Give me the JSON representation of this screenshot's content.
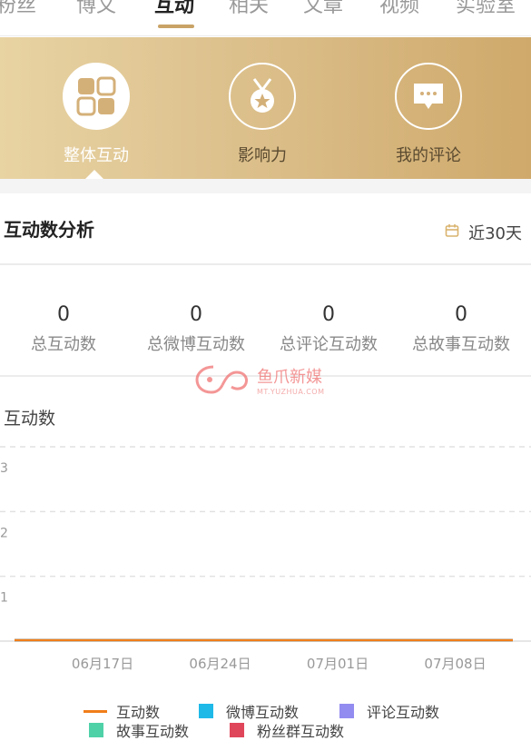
{
  "top_tabs": [
    {
      "label": "粉丝"
    },
    {
      "label": "博文"
    },
    {
      "label": "互动"
    },
    {
      "label": "相关"
    },
    {
      "label": "文章"
    },
    {
      "label": "视频"
    },
    {
      "label": "实验室"
    }
  ],
  "active_tab": "互动",
  "features": [
    {
      "label": "整体互动",
      "icon": "interaction-swap-icon"
    },
    {
      "label": "影响力",
      "icon": "medal-icon"
    },
    {
      "label": "我的评论",
      "icon": "comment-icon"
    }
  ],
  "section": {
    "title": "互动数分析",
    "date_range": "近30天",
    "calendar_icon": "calendar-icon"
  },
  "stats": [
    {
      "value": "0",
      "label": "总互动数"
    },
    {
      "value": "0",
      "label": "总微博互动数"
    },
    {
      "value": "0",
      "label": "总评论互动数"
    },
    {
      "value": "0",
      "label": "总故事互动数"
    }
  ],
  "watermark": {
    "text": "鱼爪新媒",
    "url": "MT.YUZHUA.COM"
  },
  "chart_data": {
    "type": "line",
    "title": "互动数",
    "y_ticks": [
      "3",
      "2",
      "1"
    ],
    "ylim": [
      0,
      3
    ],
    "x_labels": [
      "06月17日",
      "06月24日",
      "07月01日",
      "07月08日"
    ],
    "grid": true,
    "legend_position": "bottom",
    "series": [
      {
        "name": "互动数",
        "color": "#f07d1a",
        "values": [
          0,
          0,
          0,
          0
        ]
      },
      {
        "name": "微博互动数",
        "color": "#1fb9e8",
        "values": [
          0,
          0,
          0,
          0
        ]
      },
      {
        "name": "评论互动数",
        "color": "#938cf0",
        "values": [
          0,
          0,
          0,
          0
        ]
      },
      {
        "name": "故事互动数",
        "color": "#4fd1a8",
        "values": [
          0,
          0,
          0,
          0
        ]
      },
      {
        "name": "粉丝群互动数",
        "color": "#e0465a",
        "values": [
          0,
          0,
          0,
          0
        ]
      }
    ]
  },
  "colors": {
    "accent": "#c9a366",
    "banner_start": "#e8d3a3",
    "banner_end": "#cfa96b"
  }
}
